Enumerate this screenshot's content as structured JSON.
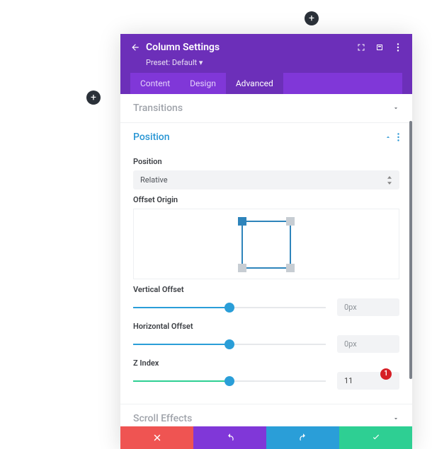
{
  "header": {
    "title": "Column Settings",
    "preset": "Preset: Default ▾"
  },
  "tabs": {
    "content": "Content",
    "design": "Design",
    "advanced": "Advanced"
  },
  "sections": {
    "transitions": "Transitions",
    "position": "Position",
    "scrollEffects": "Scroll Effects"
  },
  "position": {
    "label": "Position",
    "value": "Relative",
    "offsetOriginLabel": "Offset Origin",
    "verticalOffsetLabel": "Vertical Offset",
    "verticalOffsetValue": "0px",
    "horizontalOffsetLabel": "Horizontal Offset",
    "horizontalOffsetValue": "0px",
    "zIndexLabel": "Z Index",
    "zIndexValue": "11"
  },
  "badge": "1"
}
